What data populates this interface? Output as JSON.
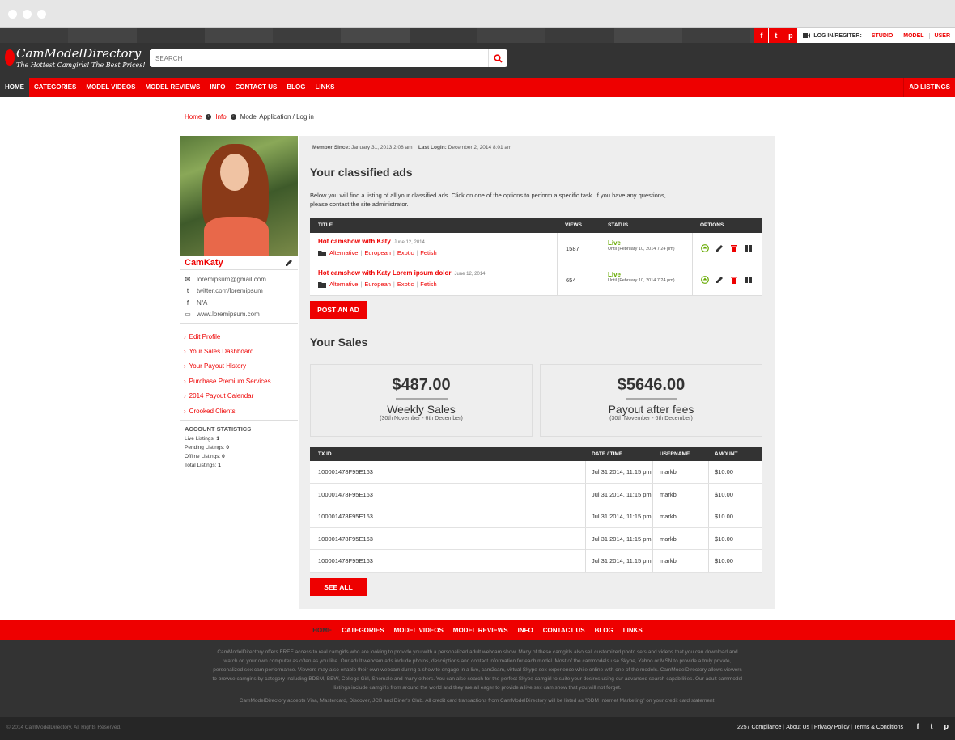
{
  "topbar": {
    "social": [
      "f",
      "t",
      "p"
    ],
    "login_label": "LOG IN/REGITER:",
    "links": [
      "STUDIO",
      "MODEL",
      "USER"
    ]
  },
  "header": {
    "logo_title": "CamModelDirectory",
    "logo_tagline": "The Hottest Camgirls! The Best Prices!",
    "search_placeholder": "SEARCH"
  },
  "nav": {
    "items": [
      "HOME",
      "CATEGORIES",
      "MODEL VIDEOS",
      "MODEL REVIEWS",
      "INFO",
      "CONTACT US",
      "BLOG",
      "LINKS"
    ],
    "right": "AD LISTINGS"
  },
  "breadcrumb": [
    "Home",
    "Info",
    "Model Application / Log in"
  ],
  "profile": {
    "name": "CamKaty",
    "email": "loremipsum@gmail.com",
    "twitter": "twitter.com/loremipsum",
    "facebook": "N/A",
    "website": "www.loremipsum.com",
    "links": [
      "Edit Profile",
      "Your Sales Dashboard",
      "Your Payout History",
      "Purchase Premium Services",
      "2014 Payout Calendar",
      "Crooked Clients"
    ],
    "stats_title": "ACCOUNT STATISTICS",
    "stats": [
      {
        "label": "Live Listings:",
        "value": "1"
      },
      {
        "label": "Pending Listings:",
        "value": "0"
      },
      {
        "label": "Offline Listings:",
        "value": "0"
      },
      {
        "label": "Total Listings:",
        "value": "1"
      }
    ]
  },
  "meta": {
    "member_since_label": "Member Since:",
    "member_since": "January 31, 2013 2:08 am",
    "last_login_label": "Last Login:",
    "last_login": "December 2, 2014 8:01 am"
  },
  "ads": {
    "title": "Your classified ads",
    "intro": "Below you will find a listing of all your classified ads. Click on one of the options to perform a specific task. If you have any questions, please contact the site administrator.",
    "columns": [
      "TITLE",
      "VIEWS",
      "STATUS",
      "OPTIONS"
    ],
    "rows": [
      {
        "title": "Hot camshow with Katy",
        "date": "June 12, 2014",
        "tags": [
          "Alternative",
          "European",
          "Exotic",
          "Fetish"
        ],
        "views": "1587",
        "status": "Live",
        "until": "Until (February 10, 2014 7:24 pm)"
      },
      {
        "title": "Hot camshow with Katy Lorem ipsum dolor",
        "date": "June 12, 2014",
        "tags": [
          "Alternative",
          "European",
          "Exotic",
          "Fetish"
        ],
        "views": "654",
        "status": "Live",
        "until": "Until (February 10, 2014 7:24 pm)"
      }
    ],
    "post_button": "POST AN AD"
  },
  "sales": {
    "title": "Your Sales",
    "boxes": [
      {
        "amount": "$487.00",
        "label": "Weekly Sales",
        "range": "(30th November - 6th December)"
      },
      {
        "amount": "$5646.00",
        "label": "Payout after fees",
        "range": "(30th November - 6th December)"
      }
    ],
    "columns": [
      "TX ID",
      "DATE / TIME",
      "USERNAME",
      "AMOUNT"
    ],
    "rows": [
      {
        "txid": "100001478F95E163",
        "date": "Jul 31 2014, 11:15 pm",
        "user": "markb",
        "amount": "$10.00"
      },
      {
        "txid": "100001478F95E163",
        "date": "Jul 31 2014, 11:15 pm",
        "user": "markb",
        "amount": "$10.00"
      },
      {
        "txid": "100001478F95E163",
        "date": "Jul 31 2014, 11:15 pm",
        "user": "markb",
        "amount": "$10.00"
      },
      {
        "txid": "100001478F95E163",
        "date": "Jul 31 2014, 11:15 pm",
        "user": "markb",
        "amount": "$10.00"
      },
      {
        "txid": "100001478F95E163",
        "date": "Jul 31 2014, 11:15 pm",
        "user": "markb",
        "amount": "$10.00"
      }
    ],
    "see_all": "SEE ALL"
  },
  "footer": {
    "nav": [
      "HOME",
      "CATEGORIES",
      "MODEL VIDEOS",
      "MODEL REVIEWS",
      "INFO",
      "CONTACT US",
      "BLOG",
      "LINKS"
    ],
    "about": "CamModelDirectory offers FREE access to real camgirls who are looking to provide you with a personalized adult webcam show. Many of these camgirls also sell customized photo sets and videos that you can download and watch on your own computer as often as you like. Our adult webcam ads include photos, descriptions and contact information for each model. Most of the cammodels use Skype, Yahoo or MSN to provide a truly private, personalized sex cam performance. Viewers may also enable their own webcam during a show to engage in a live, cam2cam, virtual Skype sex experience while online with one of the models. CamModelDirectory allows viewers to browse camgirls by category including BDSM, BBW, College Girl, Shemale and many others. You can also search for the perfect Skype camgirl to suite your desires using our advanced search capabilities. Our adult cammodel listings include camgirls from around the world and they are all eager to provide a live sex cam show that you will not forget.",
    "payments": "CamModelDirectory accepts Visa, Mastercard, Discover, JCB and Diner's Club. All credit card transactions from CamModelDirectory will be listed as \"DDM Internet Marketing\" on your credit card statement.",
    "copyright": "© 2014 CamModelDirectory. All Rights Reserved.",
    "links": [
      "2257 Compliance",
      "About Us",
      "Privacy Policy",
      "Terms & Conditions"
    ],
    "social": [
      "f",
      "t",
      "p"
    ]
  },
  "colors": {
    "accent": "#ee0000",
    "dark": "#333333",
    "live": "#66aa00"
  }
}
